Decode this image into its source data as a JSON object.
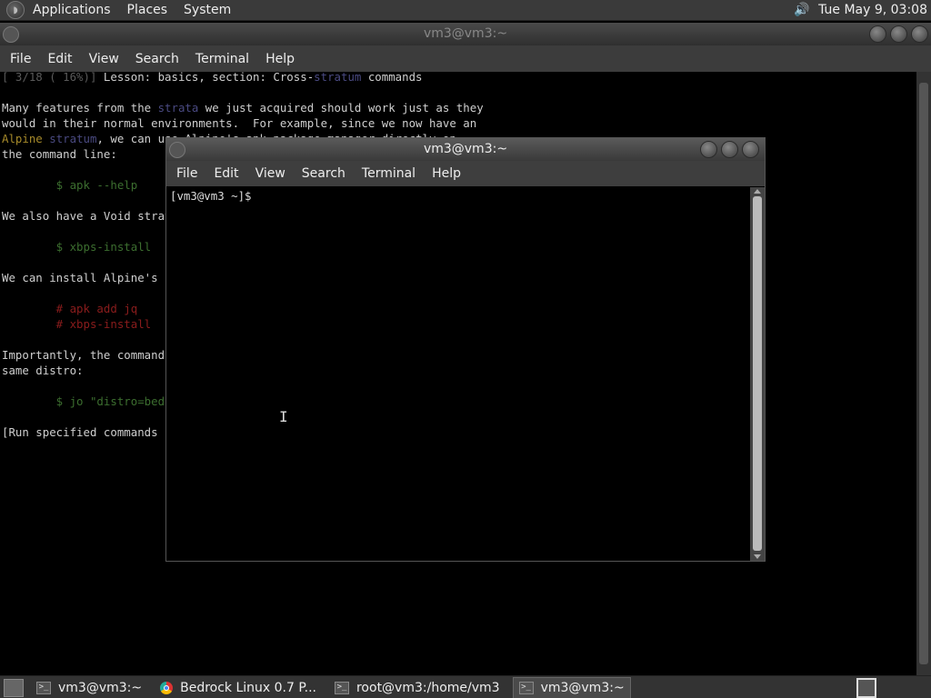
{
  "top_panel": {
    "menu": [
      "Applications",
      "Places",
      "System"
    ],
    "clock": "Tue May  9, 03:08"
  },
  "back_window": {
    "title": "vm3@vm3:~",
    "menu": [
      "File",
      "Edit",
      "View",
      "Search",
      "Terminal",
      "Help"
    ],
    "lines": [
      [
        {
          "t": "[ 3/18 ( 16%)]",
          "c": "dim"
        },
        {
          "t": " Lesson: basics, section: Cross-",
          "c": ""
        },
        {
          "t": "stratum",
          "c": "blue"
        },
        {
          "t": " commands",
          "c": ""
        }
      ],
      [],
      [
        {
          "t": "Many features from the ",
          "c": ""
        },
        {
          "t": "strata",
          "c": "blue"
        },
        {
          "t": " we just acquired should work just as they",
          "c": ""
        }
      ],
      [
        {
          "t": "would in their normal environments.  For example, since we now have an",
          "c": ""
        }
      ],
      [
        {
          "t": "Alpine",
          "c": "yellow"
        },
        {
          "t": " ",
          "c": ""
        },
        {
          "t": "stratum",
          "c": "blue"
        },
        {
          "t": ", we can use Alpine's apk package manager directly on",
          "c": ""
        }
      ],
      [
        {
          "t": "the command line:",
          "c": ""
        }
      ],
      [],
      [
        {
          "t": "        $ apk --help",
          "c": "green"
        }
      ],
      [],
      [
        {
          "t": "We also have a Void stratum, so we can use xbps-install:",
          "c": ""
        }
      ],
      [],
      [
        {
          "t": "        $ xbps-install",
          "c": "green"
        }
      ],
      [],
      [
        {
          "t": "We can install Alpine's",
          "c": ""
        }
      ],
      [],
      [
        {
          "t": "        # apk add jq",
          "c": "red"
        }
      ],
      [
        {
          "t": "        # xbps-install",
          "c": "red"
        }
      ],
      [],
      [
        {
          "t": "Importantly, the commands work together, even if they are not from the",
          "c": ""
        }
      ],
      [
        {
          "t": "same distro:",
          "c": ""
        }
      ],
      [],
      [
        {
          "t": "        $ jo \"distro=bedrock\"",
          "c": "green"
        }
      ],
      [],
      [
        {
          "t": "[Run specified commands",
          "c": ""
        }
      ]
    ]
  },
  "front_window": {
    "title": "vm3@vm3:~",
    "menu": [
      "File",
      "Edit",
      "View",
      "Search",
      "Terminal",
      "Help"
    ],
    "prompt": "[vm3@vm3 ~]$ "
  },
  "taskbar": {
    "tasks": [
      {
        "label": "vm3@vm3:~",
        "icon": "terminal-icon",
        "active": false
      },
      {
        "label": "Bedrock Linux 0.7 P...",
        "icon": "chrome-icon",
        "active": false
      },
      {
        "label": "root@vm3:/home/vm3",
        "icon": "terminal-icon",
        "active": false
      },
      {
        "label": "vm3@vm3:~",
        "icon": "terminal-icon",
        "active": true
      }
    ]
  }
}
